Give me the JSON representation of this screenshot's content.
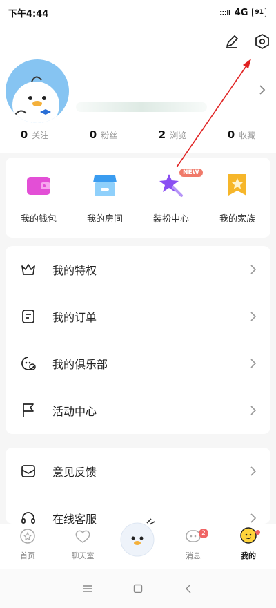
{
  "status_bar": {
    "time": "下午4:44",
    "signal": ":::ll",
    "network": "4G",
    "battery": "91"
  },
  "top_actions": {
    "edit_icon": "pencil-icon",
    "settings_icon": "settings-hexagon-icon"
  },
  "profile": {
    "avatar_icon": "duck-mascot-avatar",
    "stats": [
      {
        "num": "0",
        "label": "关注"
      },
      {
        "num": "0",
        "label": "粉丝"
      },
      {
        "num": "2",
        "label": "浏览"
      },
      {
        "num": "0",
        "label": "收藏"
      }
    ]
  },
  "quick_actions": [
    {
      "label": "我的钱包",
      "icon": "wallet-icon",
      "color": "#e34fd6"
    },
    {
      "label": "我的房间",
      "icon": "store-icon",
      "color": "#3a9cf0"
    },
    {
      "label": "装扮中心",
      "icon": "magic-wand-icon",
      "color": "#8a4ff2",
      "badge": "NEW"
    },
    {
      "label": "我的家族",
      "icon": "banner-star-icon",
      "color": "#f6b62a"
    }
  ],
  "menu_group_1": [
    {
      "label": "我的特权",
      "icon": "crown-icon"
    },
    {
      "label": "我的订单",
      "icon": "order-icon"
    },
    {
      "label": "我的俱乐部",
      "icon": "club-icon"
    },
    {
      "label": "活动中心",
      "icon": "flag-icon"
    }
  ],
  "menu_group_2": [
    {
      "label": "意见反馈",
      "icon": "feedback-icon"
    },
    {
      "label": "在线客服",
      "icon": "headset-icon"
    }
  ],
  "tabs": [
    {
      "label": "首页",
      "icon": "home-icon"
    },
    {
      "label": "聊天室",
      "icon": "heart-chat-icon"
    },
    {
      "label": "",
      "icon": "duck-mascot-icon"
    },
    {
      "label": "消息",
      "icon": "message-icon",
      "badge": "2"
    },
    {
      "label": "我的",
      "icon": "profile-icon",
      "active": true
    }
  ],
  "colors": {
    "accent_yellow": "#ffd43b",
    "badge_red": "#f06464",
    "annotation_red": "#e02020"
  }
}
